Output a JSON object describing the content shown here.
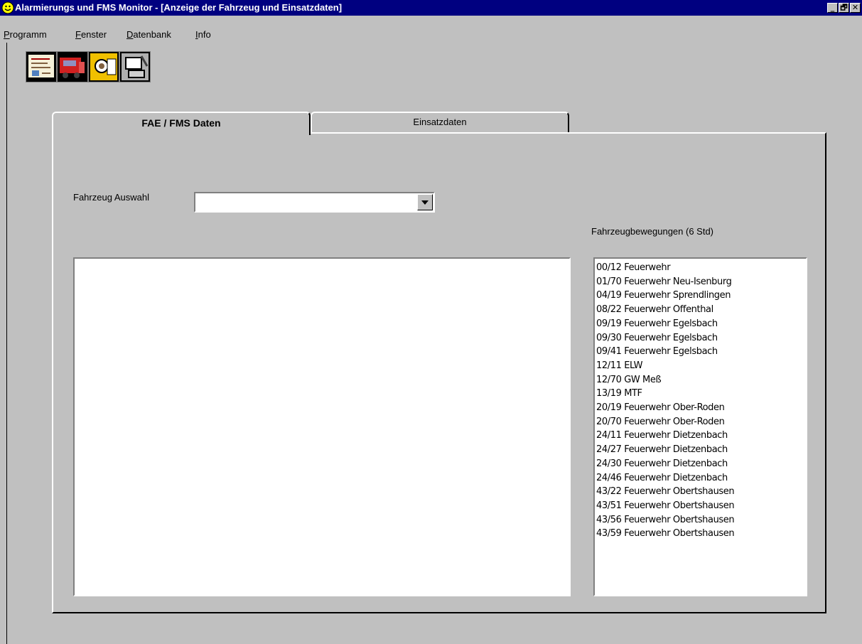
{
  "window": {
    "title": "Alarmierungs und FMS Monitor - [Anzeige der Fahrzeug und Einsatzdaten]",
    "icon": "smiley-icon",
    "buttons": [
      "_",
      "🗗",
      "✕"
    ]
  },
  "menu": [
    {
      "prefix": "",
      "underline": "P",
      "rest": "rogramm"
    },
    {
      "prefix": "",
      "underline": "F",
      "rest": "enster"
    },
    {
      "prefix": "",
      "underline": "D",
      "rest": "atenbank"
    },
    {
      "prefix": "",
      "underline": "I",
      "rest": "nfo"
    }
  ],
  "toolbar": [
    "document-icon",
    "vehicle-icon",
    "person-search-icon",
    "computer-icon"
  ],
  "tabs": {
    "active": "FAE / FMS Daten",
    "inactive": "Einsatzdaten"
  },
  "form": {
    "vehicle_label": "Fahrzeug Auswahl",
    "vehicle_value": ""
  },
  "movements": {
    "label": "Fahrzeugbewegungen (6 Std)",
    "items": [
      "00/12  Feuerwehr",
      "01/70  Feuerwehr  Neu-Isenburg",
      "04/19  Feuerwehr  Sprendlingen",
      "08/22  Feuerwehr  Offenthal",
      "09/19  Feuerwehr  Egelsbach",
      "09/30  Feuerwehr  Egelsbach",
      "09/41  Feuerwehr  Egelsbach",
      "12/11  ELW",
      "12/70  GW Meß",
      "13/19  MTF",
      "20/19  Feuerwehr  Ober-Roden",
      "20/70  Feuerwehr  Ober-Roden",
      "24/11  Feuerwehr  Dietzenbach",
      "24/27  Feuerwehr  Dietzenbach",
      "24/30  Feuerwehr  Dietzenbach",
      "24/46  Feuerwehr  Dietzenbach",
      "43/22  Feuerwehr  Obertshausen",
      "43/51  Feuerwehr  Obertshausen",
      "43/56  Feuerwehr  Obertshausen",
      "43/59  Feuerwehr  Obertshausen"
    ]
  }
}
